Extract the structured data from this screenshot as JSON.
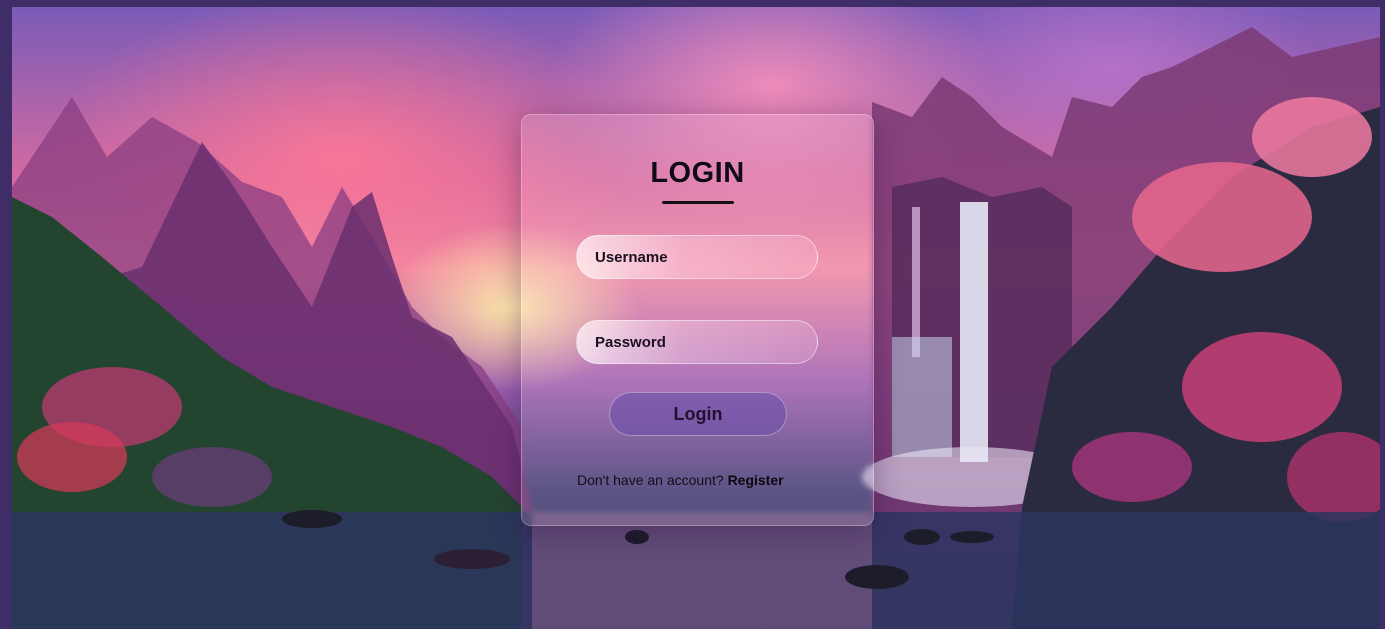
{
  "login": {
    "title": "LOGIN",
    "username_placeholder": "Username",
    "password_placeholder": "Password",
    "button_label": "Login",
    "register_prompt": "Don't have an account?",
    "register_link": "Register"
  },
  "colors": {
    "page_border": "#3e2d66",
    "button_fill": "#6e50aa",
    "title_text": "#0f0a14"
  }
}
